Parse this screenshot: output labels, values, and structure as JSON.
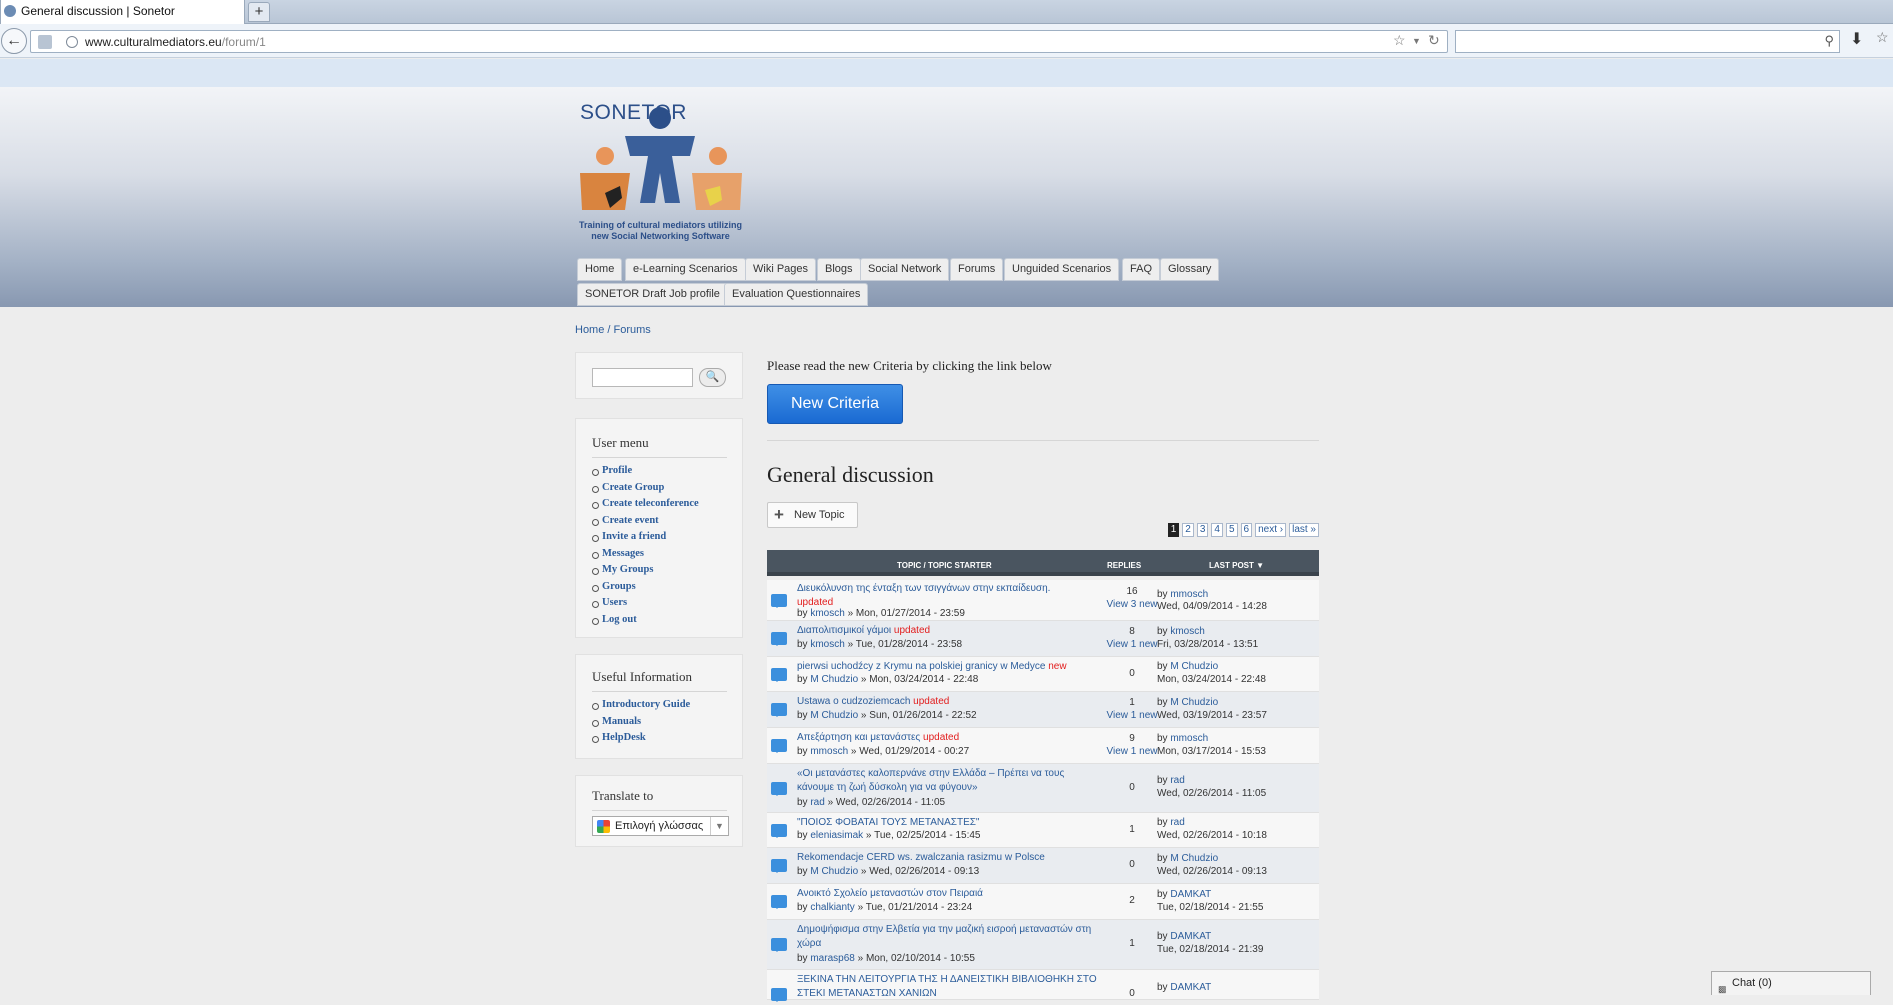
{
  "browser": {
    "tab_title": "General discussion | Sonetor",
    "new_tab": "+",
    "url_host": "www.culturalmediators.eu",
    "url_path": "/forum/1"
  },
  "site": {
    "logo_title": "SONETOR",
    "logo_tagline": "Training of cultural mediators utilizing new Social Networking Software",
    "menu": [
      {
        "label": "Home"
      },
      {
        "label": "e-Learning Scenarios"
      },
      {
        "label": "Wiki Pages"
      },
      {
        "label": "Blogs"
      },
      {
        "label": "Social Network"
      },
      {
        "label": "Forums"
      },
      {
        "label": "Unguided Scenarios"
      },
      {
        "label": "FAQ"
      },
      {
        "label": "Glossary"
      },
      {
        "label": "SONETOR Draft Job profile"
      },
      {
        "label": "Evaluation Questionnaires"
      }
    ],
    "breadcrumb": "Home / Forums"
  },
  "sidebar": {
    "user_menu_title": "User menu",
    "user_menu": [
      "Profile",
      "Create Group",
      "Create teleconference",
      "Create event",
      "Invite a friend",
      "Messages",
      "My Groups",
      "Groups",
      "Users",
      "Log out"
    ],
    "useful_title": "Useful Information",
    "useful": [
      "Introductory Guide",
      "Manuals",
      "HelpDesk"
    ],
    "translate_title": "Translate to",
    "translate_select": "Επιλογή γλώσσας"
  },
  "main": {
    "criteria_text": "Please read the new Criteria by clicking the link below",
    "criteria_button": "New Criteria",
    "forum_title": "General discussion",
    "new_topic": "New Topic",
    "pager": [
      "1",
      "2",
      "3",
      "4",
      "5",
      "6",
      "next ›",
      "last »"
    ],
    "columns": {
      "topic": "TOPIC / TOPIC STARTER",
      "replies": "REPLIES",
      "last_post": "LAST POST"
    },
    "topics": [
      {
        "title": "Διευκόλυνση της ένταξη των τσιγγάνων στην εκπαίδευση.",
        "flag": "updated",
        "starter": "kmosch",
        "date": "Mon, 01/27/2014 - 23:59",
        "replies": "16",
        "view_new": "View 3 new",
        "last_user": "mmosch",
        "last_date": "Wed, 04/09/2014 - 14:28"
      },
      {
        "title": "Διαπολιτισμικοί γάμοι",
        "flag": "updated",
        "starter": "kmosch",
        "date": "Tue, 01/28/2014 - 23:58",
        "replies": "8",
        "view_new": "View 1 new",
        "last_user": "kmosch",
        "last_date": "Fri, 03/28/2014 - 13:51"
      },
      {
        "title": "pierwsi uchodźcy z Krymu na polskiej granicy w Medyce",
        "flag": "new",
        "starter": "M Chudzio",
        "date": "Mon, 03/24/2014 - 22:48",
        "replies": "0",
        "view_new": "",
        "last_user": "M Chudzio",
        "last_date": "Mon, 03/24/2014 - 22:48"
      },
      {
        "title": "Ustawa o cudzoziemcach",
        "flag": "updated",
        "starter": "M Chudzio",
        "date": "Sun, 01/26/2014 - 22:52",
        "replies": "1",
        "view_new": "View 1 new",
        "last_user": "M Chudzio",
        "last_date": "Wed, 03/19/2014 - 23:57"
      },
      {
        "title": "Απεξάρτηση και μετανάστες",
        "flag": "updated",
        "starter": "mmosch",
        "date": "Wed, 01/29/2014 - 00:27",
        "replies": "9",
        "view_new": "View 1 new",
        "last_user": "mmosch",
        "last_date": "Mon, 03/17/2014 - 15:53"
      },
      {
        "title": "«Οι μετανάστες καλοπερνάνε στην Ελλάδα – Πρέπει να τους κάνουμε τη ζωή δύσκολη για να φύγουν»",
        "flag": "",
        "starter": "rad",
        "date": "Wed, 02/26/2014 - 11:05",
        "replies": "0",
        "view_new": "",
        "last_user": "rad",
        "last_date": "Wed, 02/26/2014 - 11:05"
      },
      {
        "title": "\"ΠΟΙΟΣ ΦΟΒΑΤΑΙ ΤΟΥΣ ΜΕΤΑΝΑΣΤΕΣ\"",
        "flag": "",
        "starter": "eleniasimak",
        "date": "Tue, 02/25/2014 - 15:45",
        "replies": "1",
        "view_new": "",
        "last_user": "rad",
        "last_date": "Wed, 02/26/2014 - 10:18"
      },
      {
        "title": "Rekomendacje CERD ws. zwalczania rasizmu w Polsce",
        "flag": "",
        "starter": "M Chudzio",
        "date": "Wed, 02/26/2014 - 09:13",
        "replies": "0",
        "view_new": "",
        "last_user": "M Chudzio",
        "last_date": "Wed, 02/26/2014 - 09:13"
      },
      {
        "title": "Ανοικτό Σχολείο μεταναστών στον Πειραιά",
        "flag": "",
        "starter": "chalkianty",
        "date": "Tue, 01/21/2014 - 23:24",
        "replies": "2",
        "view_new": "",
        "last_user": "DAMKAT",
        "last_date": "Tue, 02/18/2014 - 21:55"
      },
      {
        "title": "Δημοψήφισμα στην Ελβετία για την μαζική εισροή μεταναστών στη χώρα",
        "flag": "",
        "starter": "marasp68",
        "date": "Mon, 02/10/2014 - 10:55",
        "replies": "1",
        "view_new": "",
        "last_user": "DAMKAT",
        "last_date": "Tue, 02/18/2014 - 21:39"
      },
      {
        "title": "ΞΕΚΙΝΑ ΤΗΝ ΛΕΙΤΟΥΡΓΙΑ ΤΗΣ Η ΔΑΝΕΙΣΤΙΚΗ ΒΙΒΛΙΟΘΗΚΗ ΣΤΟ ΣΤΕΚΙ ΜΕΤΑΝΑΣΤΩΝ ΧΑΝΙΩΝ",
        "flag": "",
        "starter": "",
        "date": "",
        "replies": "0",
        "view_new": "",
        "last_user": "DAMKAT",
        "last_date": ""
      }
    ]
  },
  "chat": {
    "label": "Chat (0)"
  }
}
